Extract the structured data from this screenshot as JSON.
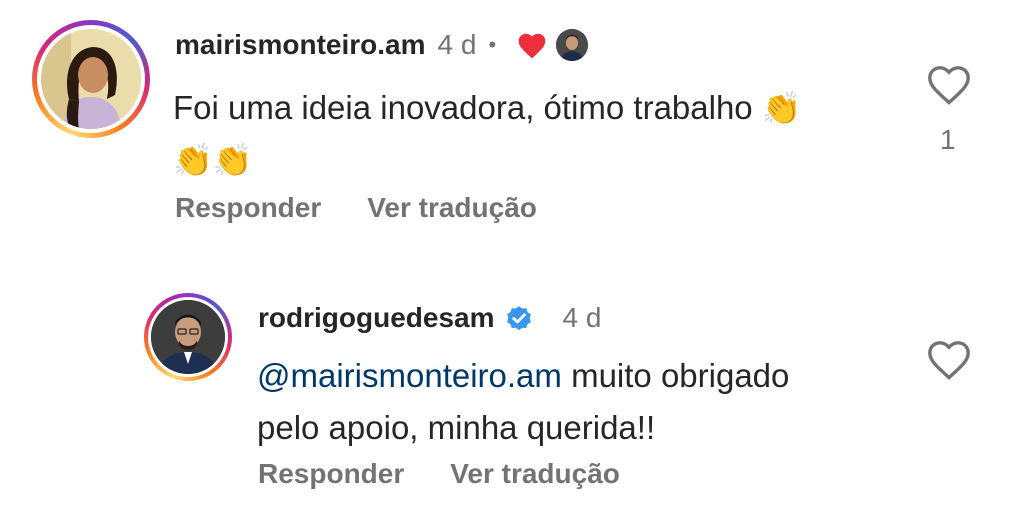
{
  "comment": {
    "username": "mairismonteiro.am",
    "time": "4 d",
    "dot": "•",
    "line1": "Foi uma ideia inovadora, ótimo trabalho",
    "emoji1": "👏",
    "emoji_line2": "👏👏",
    "reply_label": "Responder",
    "translate_label": "Ver tradução",
    "like_count": "1"
  },
  "reply": {
    "username": "rodrigoguedesam",
    "time": "4 d",
    "mention": "@mairismonteiro.am",
    "text_line1": " muito obrigado",
    "text_line2": "pelo apoio, minha querida!!",
    "reply_label": "Responder",
    "translate_label": "Ver tradução"
  },
  "colors": {
    "heart_red": "#ed2f3b",
    "verified_blue": "#3897f0",
    "mention": "#00376b",
    "muted": "#737373"
  },
  "icons": {
    "like_outline": "heart-outline-icon",
    "creator_liked": "red-heart-icon",
    "verified": "verified-badge-icon"
  }
}
